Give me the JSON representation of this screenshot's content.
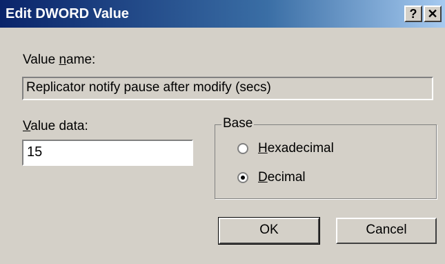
{
  "window": {
    "title": "Edit DWORD Value",
    "help_label": "?",
    "close_label": "✕"
  },
  "value_name": {
    "label_prefix": "Value ",
    "label_underlined": "n",
    "label_suffix": "ame:",
    "value": "Replicator notify pause after modify (secs)"
  },
  "value_data": {
    "label_underlined": "V",
    "label_suffix": "alue data:",
    "value": "15"
  },
  "base": {
    "legend": "Base",
    "options": [
      {
        "underlined": "H",
        "rest": "exadecimal",
        "selected": false
      },
      {
        "underlined": "D",
        "rest": "ecimal",
        "selected": true
      }
    ]
  },
  "buttons": {
    "ok_label": "OK",
    "cancel_label": "Cancel"
  }
}
